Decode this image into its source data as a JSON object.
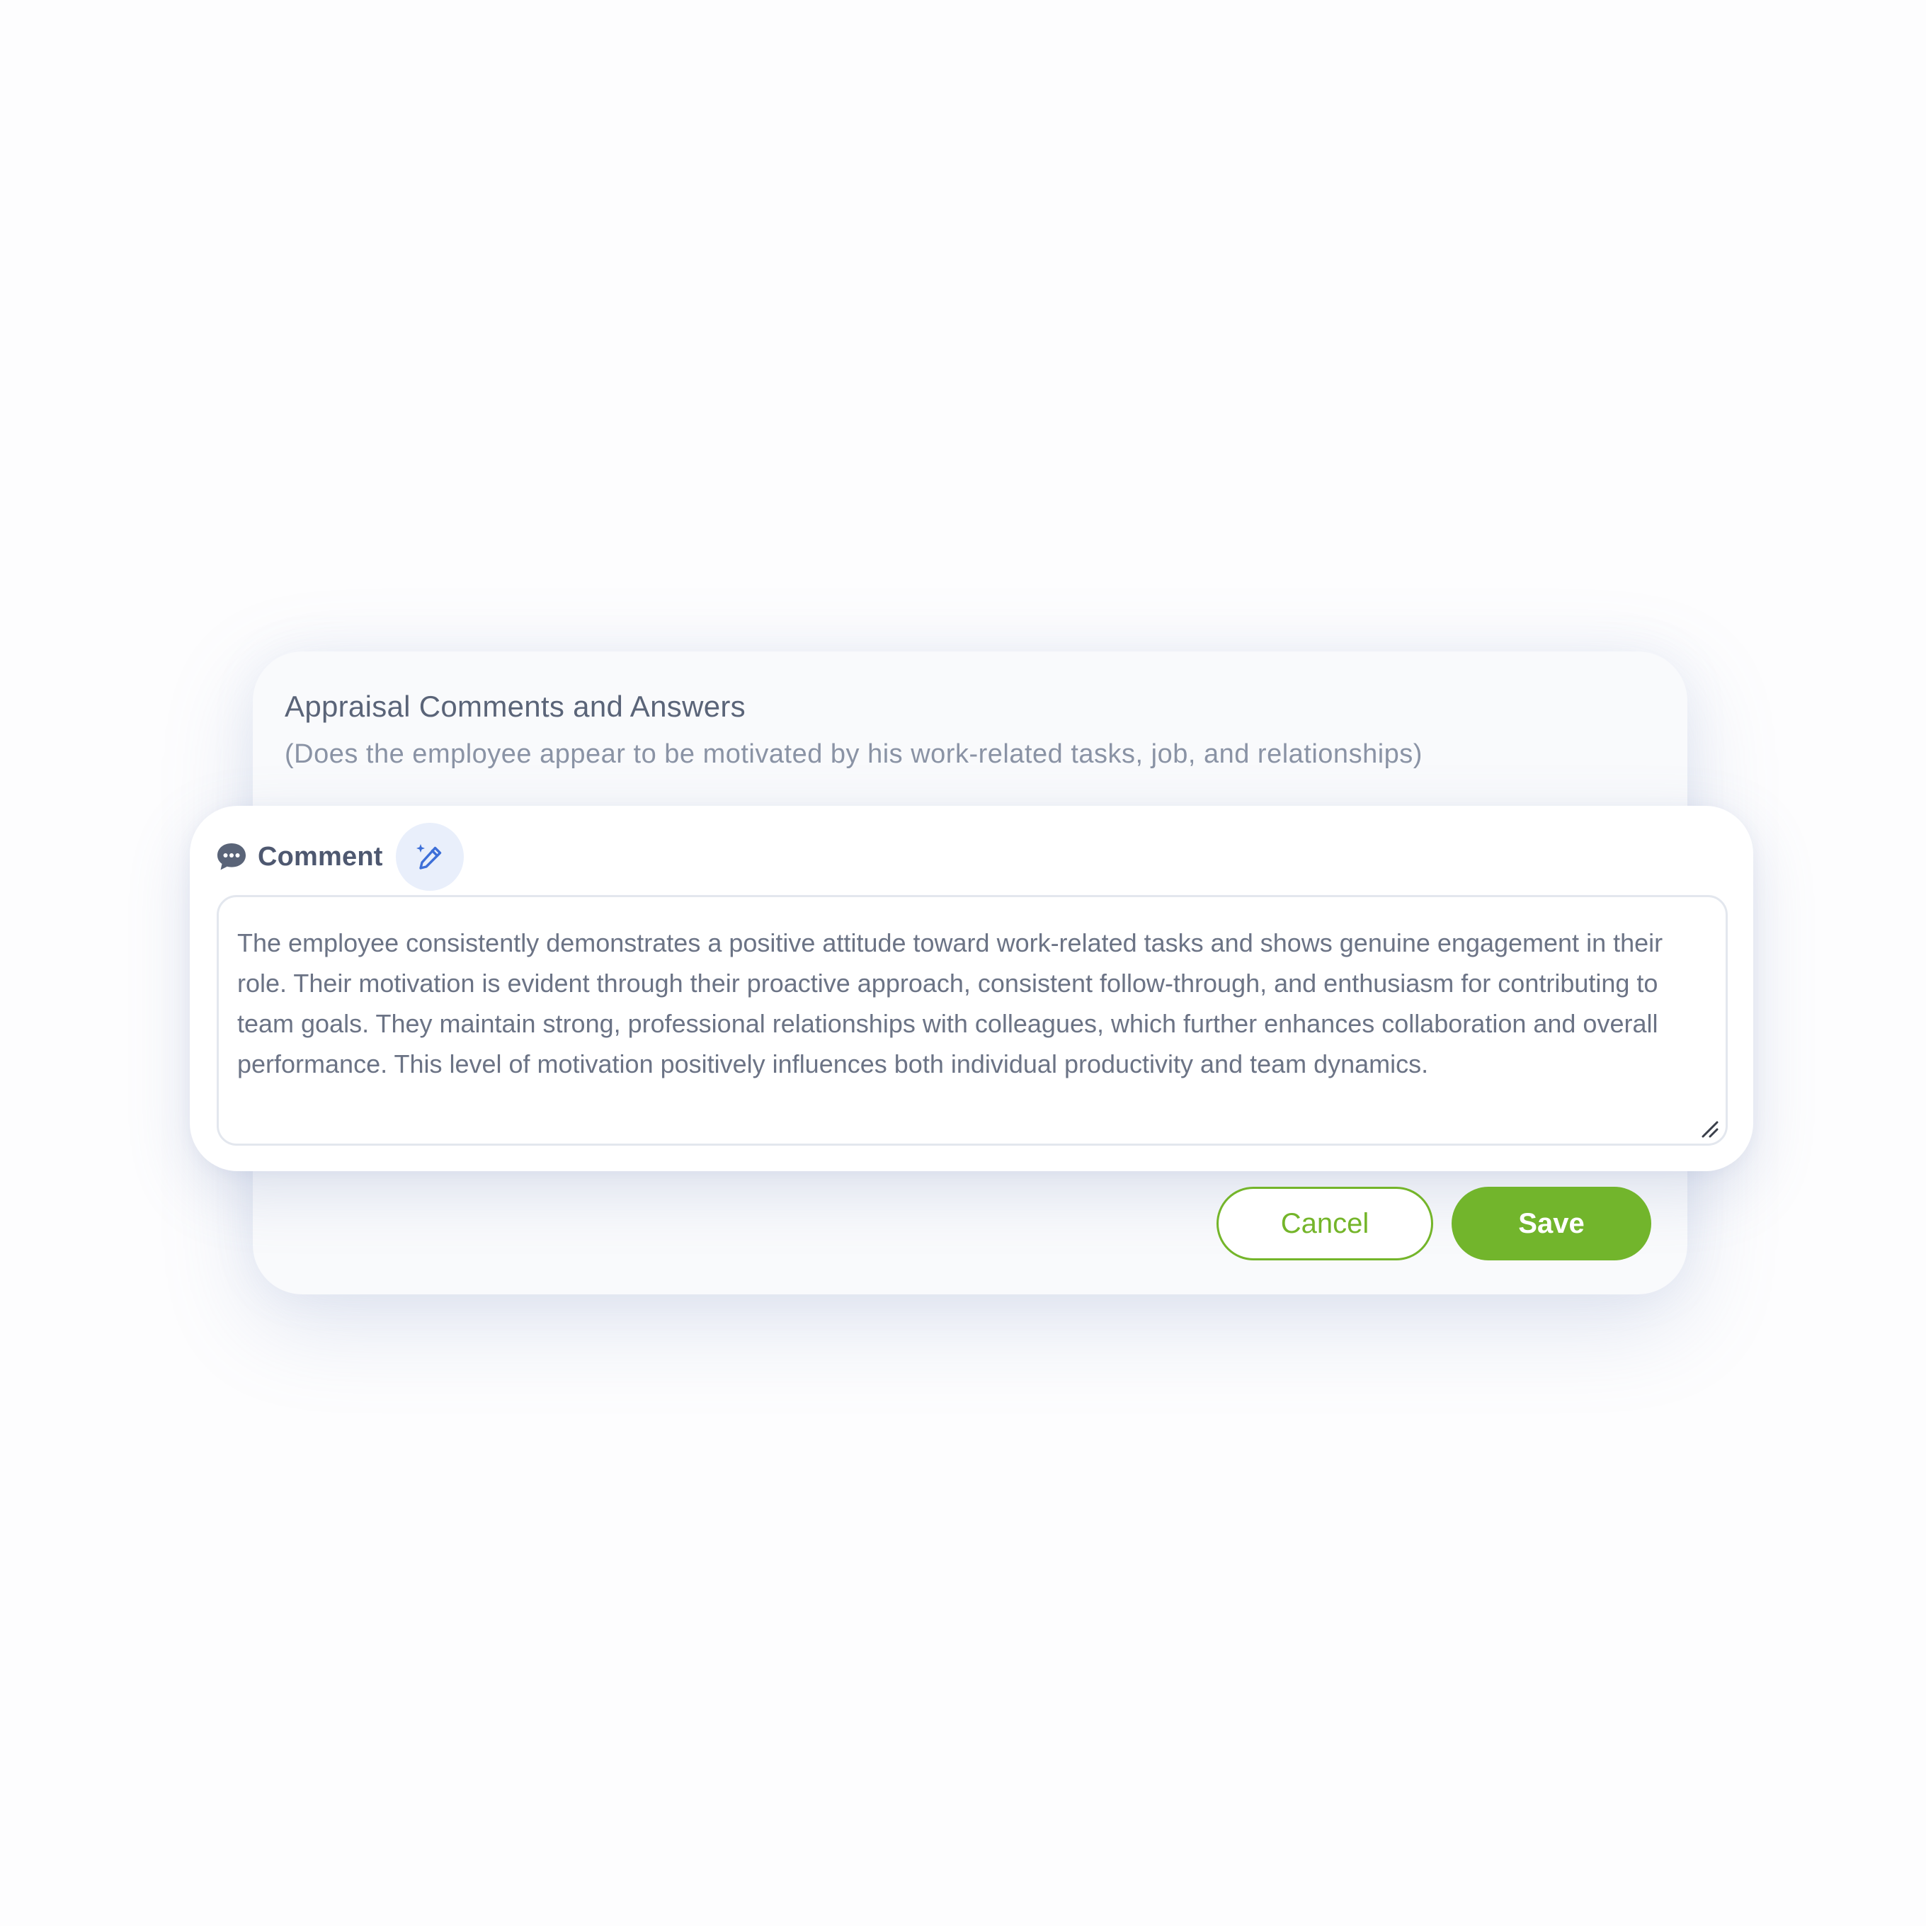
{
  "section": {
    "title": "Appraisal Comments and Answers",
    "question": "(Does the employee appear to be motivated by his work-related tasks, job, and relationships)"
  },
  "comment": {
    "label": "Comment",
    "icon": "chat-bubble-icon",
    "ai_button_icon": "magic-pen-icon",
    "text": "The employee consistently demonstrates a positive attitude toward work-related tasks and shows genuine engagement in their role. Their motivation is evident through their proactive approach, consistent follow-through, and enthusiasm for contributing to team goals. They maintain strong, professional relationships with colleagues, which further enhances collaboration and overall performance. This level of motivation positively influences both individual productivity and team dynamics."
  },
  "actions": {
    "cancel_label": "Cancel",
    "save_label": "Save"
  },
  "colors": {
    "accent_green": "#72b52c",
    "heading": "#5a6478",
    "icon_blue": "#3d6fd8"
  }
}
